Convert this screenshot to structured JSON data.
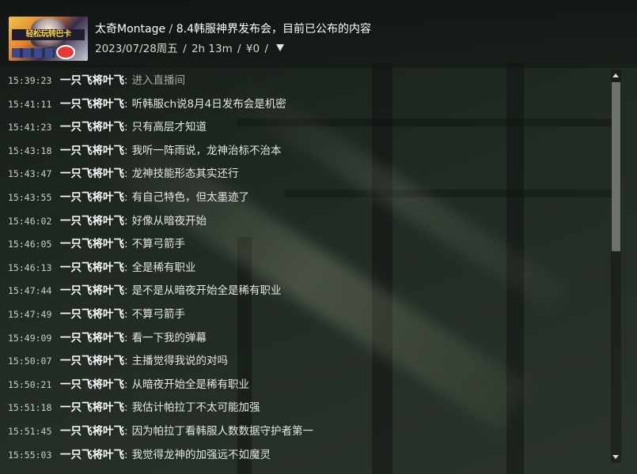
{
  "header": {
    "title_streamer": "太奇Montage",
    "title_separator": "/",
    "title_topic": "8.4韩服神界发布会，目前已公布的内容",
    "date": "2023/07/28周五",
    "duration": "2h 13m",
    "gift_total": "¥0",
    "meta_separator": "/",
    "filter_icon": "filter-triangle-icon",
    "thumbnail_banner": "轻松玩转巴卡"
  },
  "messages": [
    {
      "time": "15:39:23",
      "user": "一只飞将叶飞",
      "colon": ":",
      "text": "进入直播间",
      "system": true
    },
    {
      "time": "15:41:11",
      "user": "一只飞将叶飞",
      "colon": ":",
      "text": "听韩服ch说8月4日发布会是机密"
    },
    {
      "time": "15:41:23",
      "user": "一只飞将叶飞",
      "colon": ":",
      "text": "只有高层才知道"
    },
    {
      "time": "15:43:18",
      "user": "一只飞将叶飞",
      "colon": ":",
      "text": "我听一阵雨说，龙神治标不治本"
    },
    {
      "time": "15:43:47",
      "user": "一只飞将叶飞",
      "colon": ":",
      "text": "龙神技能形态其实还行"
    },
    {
      "time": "15:43:55",
      "user": "一只飞将叶飞",
      "colon": ":",
      "text": "有自己特色，但太墨迹了"
    },
    {
      "time": "15:46:02",
      "user": "一只飞将叶飞",
      "colon": ":",
      "text": "好像从暗夜开始"
    },
    {
      "time": "15:46:05",
      "user": "一只飞将叶飞",
      "colon": ":",
      "text": "不算弓箭手"
    },
    {
      "time": "15:46:13",
      "user": "一只飞将叶飞",
      "colon": ":",
      "text": "全是稀有职业"
    },
    {
      "time": "15:47:44",
      "user": "一只飞将叶飞",
      "colon": ":",
      "text": "是不是从暗夜开始全是稀有职业"
    },
    {
      "time": "15:47:49",
      "user": "一只飞将叶飞",
      "colon": ":",
      "text": "不算弓箭手"
    },
    {
      "time": "15:49:09",
      "user": "一只飞将叶飞",
      "colon": ":",
      "text": "看一下我的弹幕"
    },
    {
      "time": "15:50:07",
      "user": "一只飞将叶飞",
      "colon": ":",
      "text": "主播觉得我说的对吗"
    },
    {
      "time": "15:50:21",
      "user": "一只飞将叶飞",
      "colon": ":",
      "text": "从暗夜开始全是稀有职业"
    },
    {
      "time": "15:51:18",
      "user": "一只飞将叶飞",
      "colon": ":",
      "text": "我估计帕拉丁不太可能加强"
    },
    {
      "time": "15:51:45",
      "user": "一只飞将叶飞",
      "colon": ":",
      "text": "因为帕拉丁看韩服人数数据守护者第一"
    },
    {
      "time": "15:55:03",
      "user": "一只飞将叶飞",
      "colon": ":",
      "text": "我觉得龙神的加强远不如魔灵"
    }
  ],
  "scrollbar": {
    "position_fraction": 0.0,
    "visible_fraction": 0.46
  }
}
